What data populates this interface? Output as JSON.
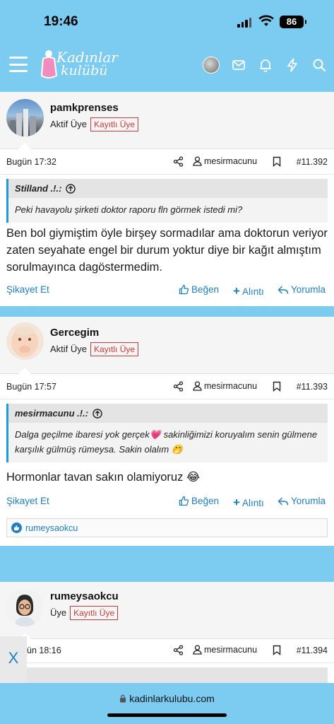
{
  "status": {
    "time": "19:46",
    "battery": "86"
  },
  "site": {
    "logo_line1": "Kadınlar",
    "logo_line2": "kulübü"
  },
  "posts": [
    {
      "username": "pamkprenses",
      "role": "Aktif Üye",
      "badge": "Kayıtlı Üye",
      "date": "Bugün 17:32",
      "author": "mesirmacunu",
      "number": "#11.392",
      "quote_author": "Stilland .!.:",
      "quote_text": "Peki havayolu şirketi doktor raporu fln görmek istedi mi?",
      "text": "Ben bol giymiştim öyle birşey sormadılar ama doktorun veriyor zaten seyahate engel bir durum yoktur diye bir kağıt almıştım sorulmayınca dagöstermedim."
    },
    {
      "username": "Gercegim",
      "role": "Aktif Üye",
      "badge": "Kayıtlı Üye",
      "date": "Bugün 17:57",
      "author": "mesirmacunu",
      "number": "#11.393",
      "quote_author": "mesirmacunu .!.:",
      "quote_text_a": "Dalga geçilme ibaresi yok gerçek",
      "quote_emoji_a": "💗",
      "quote_text_b": "sakinliğimizi koruyalım senin gülmene karşılık gülmüş rümeysa. Sakin olalım",
      "quote_emoji_b": "🤭",
      "text": "Hormonlar tavan sakın olamiyoruz",
      "text_emoji": "😂",
      "reaction_user": "rumeysaokcu"
    },
    {
      "username": "rumeysaokcu",
      "role": "Üye",
      "badge": "Kayıtlı Üye",
      "date": "ün 18:16",
      "author": "mesirmacunu",
      "number": "#11.394"
    }
  ],
  "actions": {
    "report": "Şikayet Et",
    "like": "Beğen",
    "quote": "Alıntı",
    "reply": "Yorumla"
  },
  "close_label": "X",
  "url": "kadinlarkulubu.com"
}
